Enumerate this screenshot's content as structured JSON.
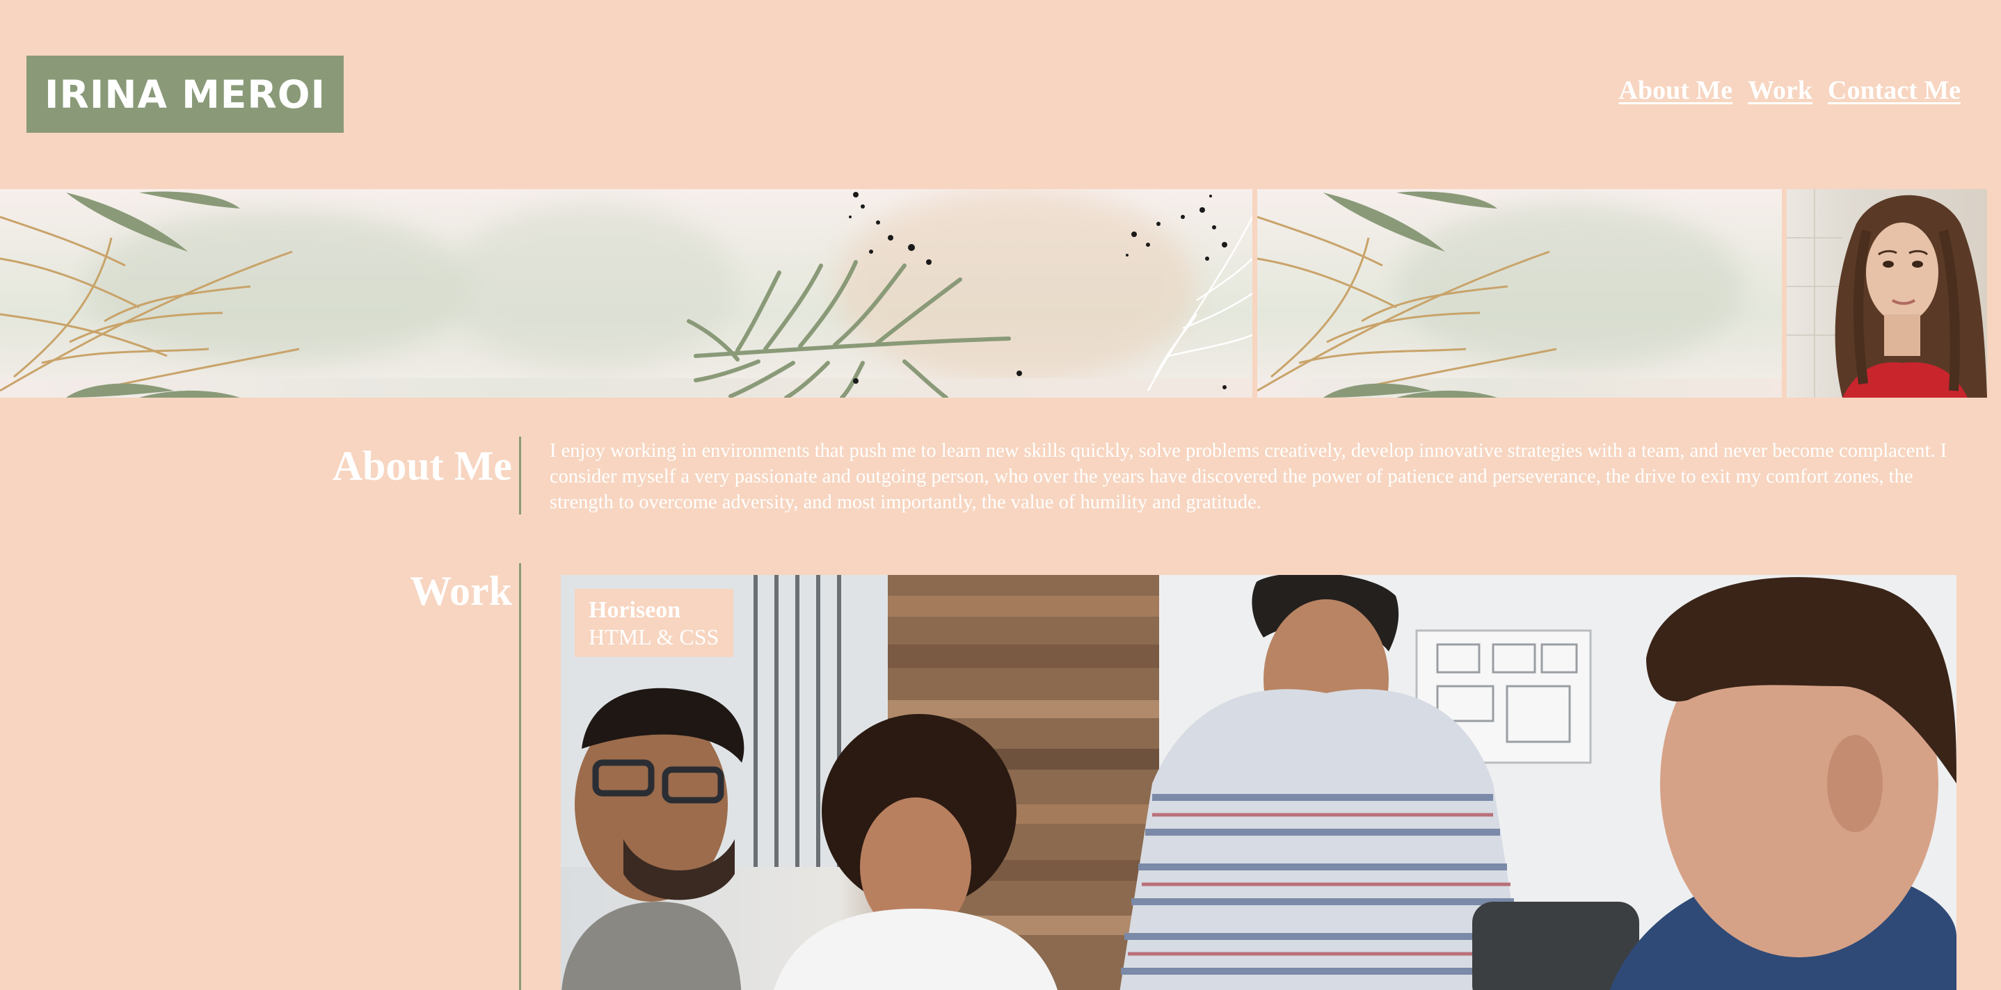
{
  "header": {
    "logo": "IRINA MEROI",
    "nav": [
      {
        "label": "About Me"
      },
      {
        "label": "Work"
      },
      {
        "label": "Contact Me"
      }
    ]
  },
  "about": {
    "title": "About Me",
    "text": "I enjoy working in environments that push me to learn new skills quickly, solve problems creatively, develop innovative strategies with a team, and never become complacent. I consider myself a very passionate and outgoing person, who over the years have discovered the power of patience and perseverance, the drive to exit my comfort zones, the strength to overcome adversity, and most importantly, the value of humility and gratitude."
  },
  "work": {
    "title": "Work",
    "projects": [
      {
        "name": "Horiseon",
        "tech": "HTML & CSS"
      }
    ]
  },
  "colors": {
    "background": "#f7d5c0",
    "accent_green": "#8a9a78",
    "text": "#ffffff"
  },
  "icons": {
    "banner": "botanical-leaf-banner-image",
    "profile": "profile-photo",
    "work_image": "team-meeting-photo"
  }
}
